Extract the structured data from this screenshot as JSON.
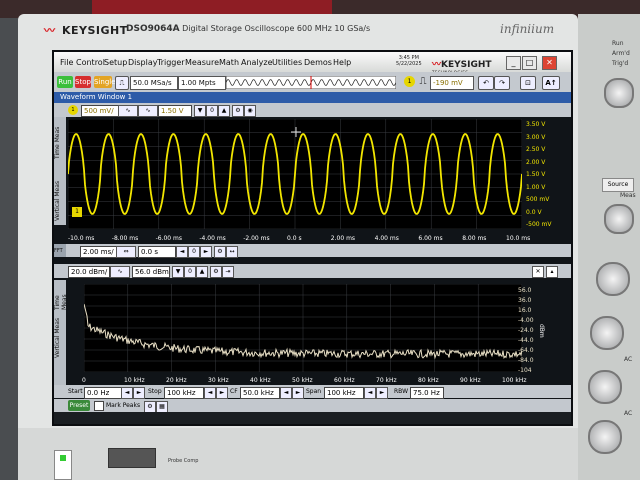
{
  "brand": {
    "name": "KEYSIGHT",
    "model": "DSO9064A",
    "description": "Digital Storage Oscilloscope 600 MHz 10 GSa/s",
    "series": "infiniium"
  },
  "menu": [
    "File",
    "Control",
    "Setup",
    "Display",
    "Trigger",
    "Measure",
    "Math",
    "Analyze",
    "Utilities",
    "Demos",
    "Help"
  ],
  "datetime": {
    "time": "3:45 PM",
    "date": "5/22/2025"
  },
  "keysight_logo": {
    "text": "KEYSIGHT",
    "sub": "TECHNOLOGIES"
  },
  "toolbar": {
    "run_label": "Run",
    "stop_label": "Stop",
    "single_label": "Single",
    "sample_rate": "50.0 MSa/s",
    "memory_depth": "1.00 Mpts",
    "trigger_level": "-190 mV"
  },
  "window_title": "Waveform Window 1",
  "ch1": {
    "vertical_scale": "500 mV/",
    "offset": "1.50 V",
    "side_tabs": [
      "Time Meas",
      "Vertical Meas"
    ],
    "right_scale": [
      "3.50 V",
      "3.00 V",
      "2.50 V",
      "2.00 V",
      "1.50 V",
      "1.00 V",
      "500 mV",
      "0.0 V",
      "-500 mV"
    ],
    "x_ticks": [
      "-10.0 ms",
      "-8.00 ms",
      "-6.00 ms",
      "-4.00 ms",
      "-2.00 ms",
      "0.0 s",
      "2.00 ms",
      "4.00 ms",
      "6.00 ms",
      "8.00 ms",
      "10.0 ms"
    ],
    "time_scale": "2.00 ms/",
    "time_position": "0.0 s",
    "badge": "1"
  },
  "fft": {
    "label": "FFT",
    "vertical_scale": "20.0 dBm/",
    "offset": "56.0 dBm",
    "side_tabs": [
      "Time Meas",
      "Vertical Meas"
    ],
    "right_scale": [
      "56.0",
      "36.0",
      "16.0",
      "-4.00",
      "-24.0",
      "-44.0",
      "-64.0",
      "-84.0",
      "-104"
    ],
    "unit": "dBm",
    "x_ticks": [
      "0",
      "10 kHz",
      "20 kHz",
      "30 kHz",
      "40 kHz",
      "50 kHz",
      "60 kHz",
      "70 kHz",
      "80 kHz",
      "90 kHz",
      "100 kHz"
    ],
    "trace_label": "f1",
    "start_label": "Start",
    "start_value": "0.0 Hz",
    "stop_label": "Stop",
    "stop_value": "100 kHz",
    "cf_label": "CF",
    "cf_value": "50.0 kHz",
    "span_label": "Span",
    "span_value": "100 kHz",
    "rbw_label": "RBW",
    "rbw_value": "75.0 Hz",
    "preset_label": "Preset",
    "mark_peaks_label": "Mark Peaks"
  },
  "waveform": {
    "cycles": 14,
    "color": "#f2e600",
    "fft_color": "#e9e0c6"
  },
  "probe_comp": "Probe Comp",
  "side_panel": {
    "run_label": "Run",
    "arm_label": "Arm'd",
    "trigd_label": "Trig'd",
    "source_label": "Source",
    "meas_label": "Meas",
    "ac_label": "AC"
  }
}
